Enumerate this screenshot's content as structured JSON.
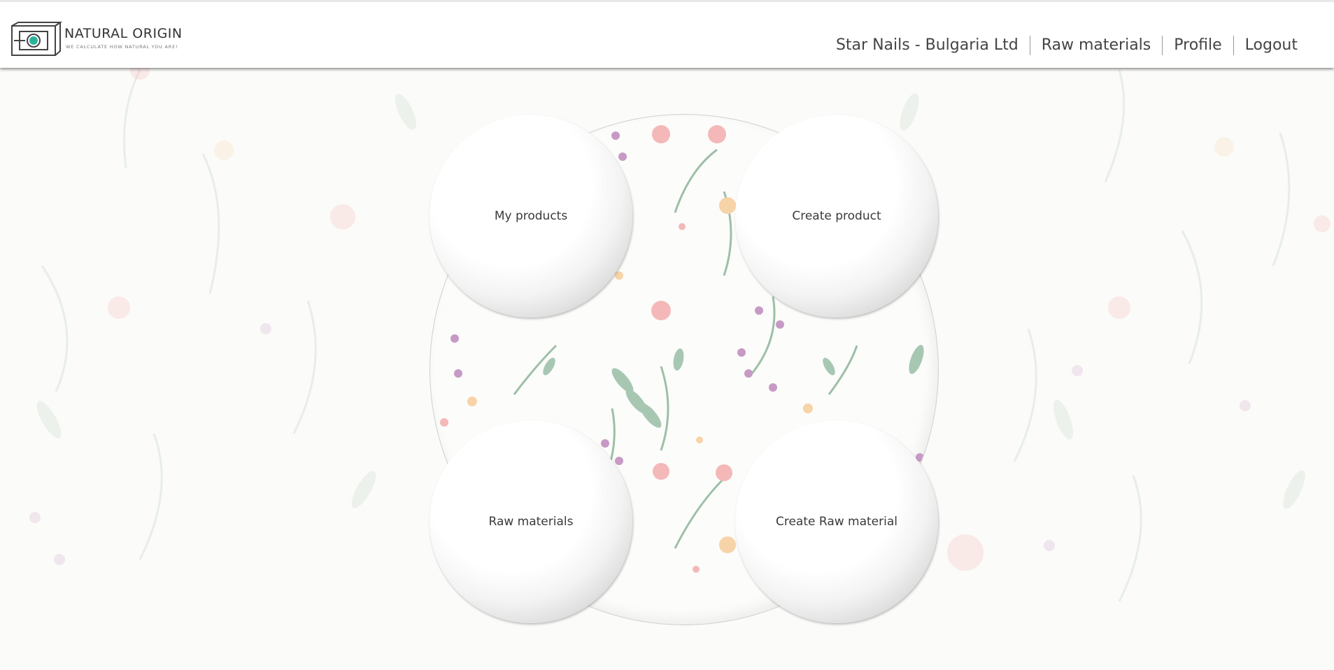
{
  "brand": {
    "title": "NATURAL ORIGIN",
    "tagline": "WE CALCULATE HOW NATURAL YOU ARE!",
    "icon": "logo-box-icon"
  },
  "nav": {
    "company": "Star Nails - Bulgaria Ltd",
    "raw_materials": "Raw materials",
    "profile": "Profile",
    "logout": "Logout"
  },
  "tiles": {
    "my_products": "My products",
    "create_product": "Create product",
    "raw_materials": "Raw materials",
    "create_raw_material": "Create Raw material"
  },
  "colors": {
    "accent": "#2bb39a",
    "leaf": "#8fb5a0",
    "flower_pink": "#f0a9a9",
    "flower_purple": "#c79ac6"
  }
}
